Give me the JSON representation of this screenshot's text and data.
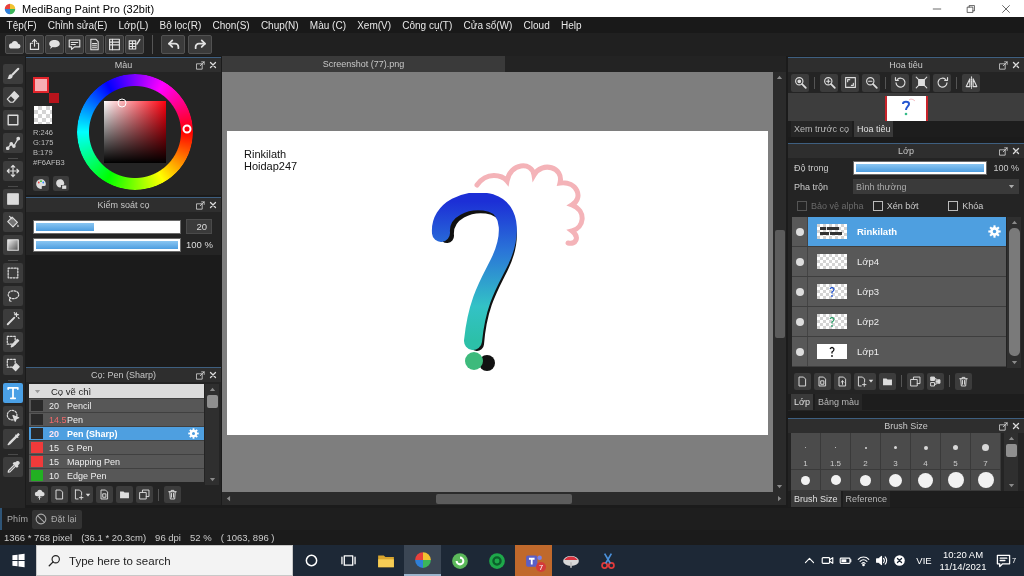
{
  "window": {
    "title": "MediBang Paint Pro (32bit)"
  },
  "menu": [
    "Tệp(F)",
    "Chỉnh sửa(E)",
    "Lớp(L)",
    "Bộ lọc(R)",
    "Chọn(S)",
    "Chụp(N)",
    "Màu (C)",
    "Xem(V)",
    "Công cụ(T)",
    "Cửa sổ(W)",
    "Cloud",
    "Help"
  ],
  "tool_groups": [
    [
      {
        "selected": false
      },
      {
        "selected": false
      },
      {
        "selected": false
      },
      {
        "selected": false
      }
    ],
    [
      {
        "selected": false
      }
    ],
    [
      {
        "selected": false
      },
      {
        "selected": false
      },
      {
        "selected": false
      }
    ],
    [
      {
        "selected": false
      },
      {
        "selected": false
      },
      {
        "selected": false
      },
      {
        "selected": false
      },
      {
        "selected": false
      }
    ],
    [
      {
        "selected": true
      },
      {
        "selected": false
      },
      {
        "selected": false
      }
    ],
    [
      {
        "selected": false
      }
    ]
  ],
  "color_panel": {
    "title": "Màu",
    "swatches": [
      {
        "color": "#f6afb3"
      },
      {
        "color": "#b8141c"
      }
    ],
    "red": "R:246",
    "green": "G:175",
    "blue": "B:179",
    "hex": "#F6AFB3"
  },
  "brush_control": {
    "title": "Kiểm soát cọ",
    "size": {
      "level": 0.41,
      "value": "20"
    },
    "opacity": {
      "level": 1,
      "value": "100 %"
    }
  },
  "brush_panel": {
    "title": "Cọ: Pen (Sharp)",
    "group": {
      "label": "Cọ vẽ chì",
      "expanded": true
    },
    "brushes": [
      {
        "color": "#2a2a2a",
        "size": "20",
        "name": "Pencil",
        "modified": false,
        "selected": false
      },
      {
        "color": "#2a2a2a",
        "size": "14.5",
        "name": "Pen",
        "modified": true,
        "selected": false
      },
      {
        "color": "#2a2a2a",
        "size": "20",
        "name": "Pen (Sharp)",
        "modified": true,
        "selected": true
      },
      {
        "color": "#f03a3a",
        "size": "15",
        "name": "G Pen",
        "modified": false,
        "selected": false
      },
      {
        "color": "#f03a3a",
        "size": "15",
        "name": "Mapping Pen",
        "modified": false,
        "selected": false
      },
      {
        "color": "#22b022",
        "size": "10",
        "name": "Edge Pen",
        "modified": false,
        "selected": false
      }
    ]
  },
  "canvas": {
    "tab": "Screenshot (77).png",
    "text_lines": [
      "Rinkilath",
      "Hoidap247"
    ]
  },
  "navigator": {
    "title": "Hoa tiêu",
    "tabs": [
      {
        "label": "Xem trước cọ",
        "selected": false
      },
      {
        "label": "Hoa tiêu",
        "selected": true
      }
    ]
  },
  "layers_panel": {
    "title": "Lớp",
    "opacity": {
      "label": "Độ trong",
      "level": 1,
      "value": "100 %"
    },
    "blend": {
      "label": "Pha trộn",
      "value": "Bình thường"
    },
    "options": [
      {
        "label": "Bảo vệ alpha",
        "checked": false,
        "disabled": true
      },
      {
        "label": "Xén bớt",
        "checked": false,
        "disabled": false
      },
      {
        "label": "Khóa",
        "checked": false,
        "disabled": false
      }
    ],
    "layers": [
      {
        "name": "Rinkilath",
        "visible": true,
        "selected": true
      },
      {
        "name": "Lớp4",
        "visible": true,
        "selected": false
      },
      {
        "name": "Lớp3",
        "visible": true,
        "selected": false
      },
      {
        "name": "Lớp2",
        "visible": true,
        "selected": false
      },
      {
        "name": "Lớp1",
        "visible": true,
        "selected": false
      }
    ],
    "tabs": [
      {
        "label": "Lớp",
        "selected": true
      },
      {
        "label": "Bảng màu",
        "selected": false
      }
    ]
  },
  "brush_size_panel": {
    "title": "Brush Size",
    "sizes": [
      "1",
      "1.5",
      "2",
      "3",
      "4",
      "5",
      "7"
    ],
    "tabs": [
      {
        "label": "Brush Size",
        "selected": true
      },
      {
        "label": "Reference",
        "selected": false
      }
    ]
  },
  "shortcut_bar": {
    "label": "Phím",
    "reset_button": "Đặt lại"
  },
  "status_bar": [
    "1366 * 768 pixel",
    "(36.1 * 20.3cm)",
    "96 dpi",
    "52 %",
    "( 1063, 896 )"
  ],
  "taskbar": {
    "search": {
      "placeholder": "Type here to search"
    },
    "apps": [
      {
        "active": false,
        "flashing": false
      },
      {
        "active": true,
        "flashing": false
      },
      {
        "active": false,
        "flashing": false
      },
      {
        "active": false,
        "flashing": false
      },
      {
        "active": false,
        "flashing": true,
        "badge": "7"
      },
      {
        "active": false,
        "flashing": false
      },
      {
        "active": false,
        "flashing": false
      }
    ],
    "language": "VIE",
    "time": "10:20 AM",
    "date": "11/14/2021",
    "notification_count": "7"
  }
}
